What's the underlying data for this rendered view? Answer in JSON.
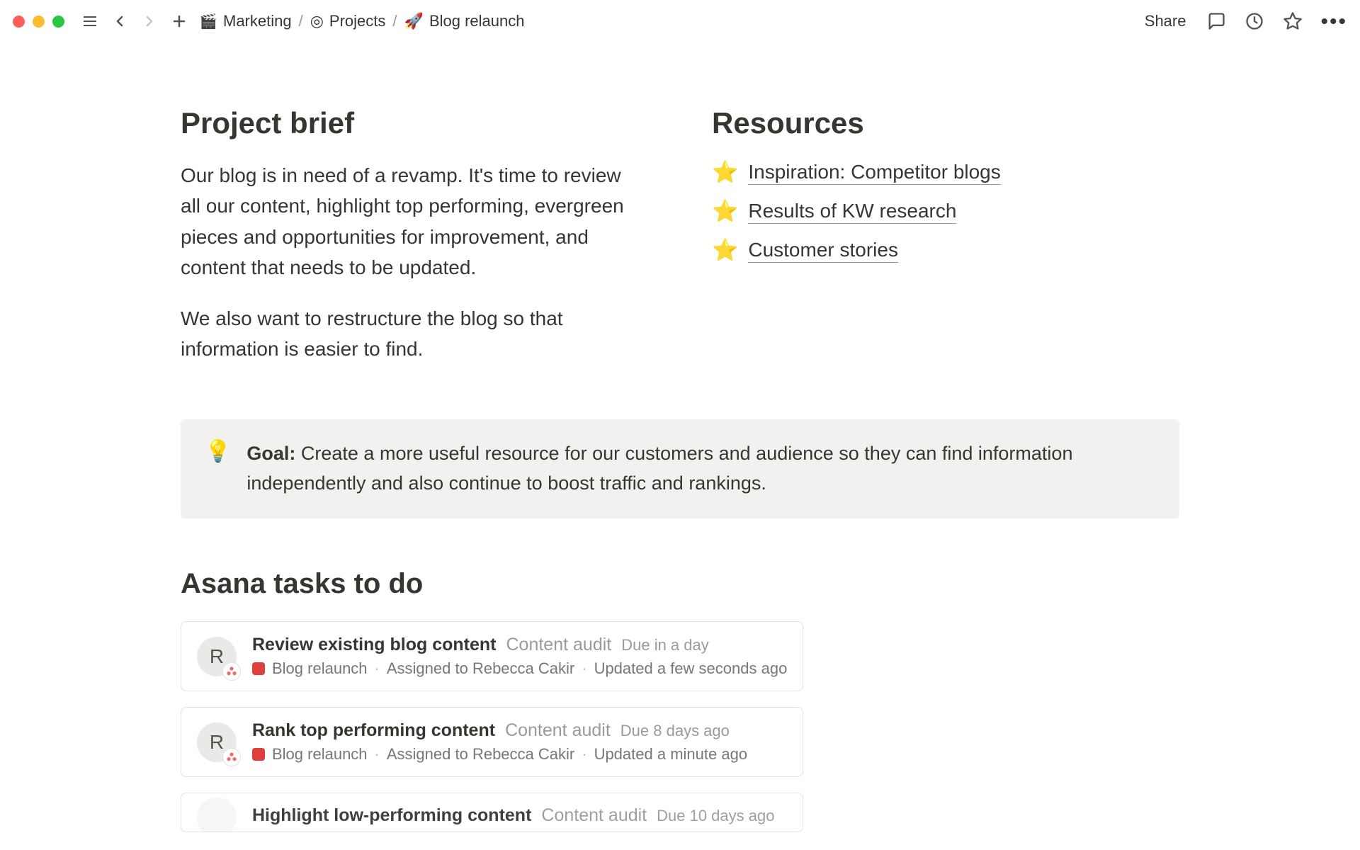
{
  "topbar": {
    "breadcrumb": [
      {
        "icon": "🎬",
        "label": "Marketing"
      },
      {
        "icon": "◎",
        "label": "Projects"
      },
      {
        "icon": "🚀",
        "label": "Blog relaunch"
      }
    ],
    "share_label": "Share"
  },
  "brief": {
    "title": "Project brief",
    "paragraphs": [
      "Our blog is in need of a revamp. It's time to review all our content, highlight top performing, evergreen pieces and opportunities for improvement, and content that needs to be updated.",
      "We also want to restructure the blog so that information is easier to find."
    ]
  },
  "resources": {
    "title": "Resources",
    "items": [
      {
        "icon": "⭐",
        "label": "Inspiration: Competitor blogs"
      },
      {
        "icon": "⭐",
        "label": "Results of KW research"
      },
      {
        "icon": "⭐",
        "label": "Customer stories"
      }
    ]
  },
  "callout": {
    "icon": "💡",
    "label": "Goal:",
    "text": "Create a more useful resource for our customers and audience so they can find information independently and also continue to boost traffic and rankings."
  },
  "tasks": {
    "title": "Asana tasks to do",
    "items": [
      {
        "avatar_initial": "R",
        "title": "Review existing blog content",
        "category": "Content audit",
        "due": "Due in a day",
        "project": "Blog relaunch",
        "assignee": "Assigned to Rebecca Cakir",
        "updated": "Updated a few seconds ago"
      },
      {
        "avatar_initial": "R",
        "title": "Rank top performing content",
        "category": "Content audit",
        "due": "Due 8 days ago",
        "project": "Blog relaunch",
        "assignee": "Assigned to Rebecca Cakir",
        "updated": "Updated a minute ago"
      },
      {
        "avatar_initial": "",
        "title": "Highlight low-performing content",
        "category": "Content audit",
        "due": "Due 10 days ago",
        "project": "",
        "assignee": "",
        "updated": ""
      }
    ]
  }
}
